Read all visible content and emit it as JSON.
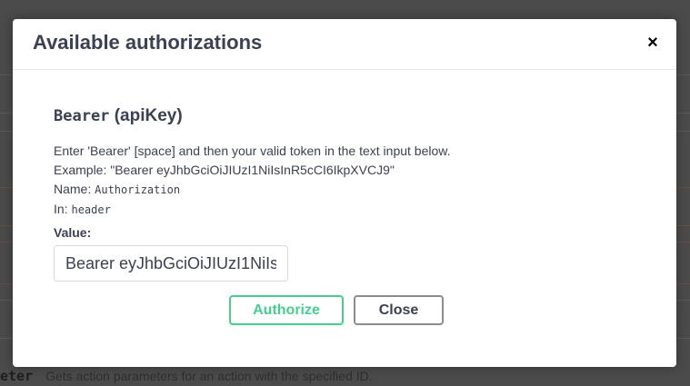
{
  "background": {
    "bottom_code": "eter",
    "bottom_description": "Gets action parameters for an action with the specified ID."
  },
  "modal": {
    "title": "Available authorizations",
    "close_icon_glyph": "×",
    "auth": {
      "name": "Bearer",
      "type": "(apiKey)",
      "description_line1": "Enter 'Bearer' [space] and then your valid token in the text input below.",
      "description_line2": "Example: \"Bearer eyJhbGciOiJIUzI1NiIsInR5cCI6IkpXVCJ9\"",
      "name_label": "Name:",
      "name_value": "Authorization",
      "in_label": "In:",
      "in_value": "header",
      "value_label": "Value:",
      "value_input": "Bearer eyJhbGciOiJIUzI1NiIs"
    },
    "buttons": {
      "authorize": "Authorize",
      "close": "Close"
    }
  },
  "colors": {
    "overlay": "#4b4b4b",
    "text": "#3b4151",
    "authorize_accent": "#49cc90",
    "close_border": "#8c8c8c"
  },
  "icons": {
    "close": "close-icon"
  }
}
